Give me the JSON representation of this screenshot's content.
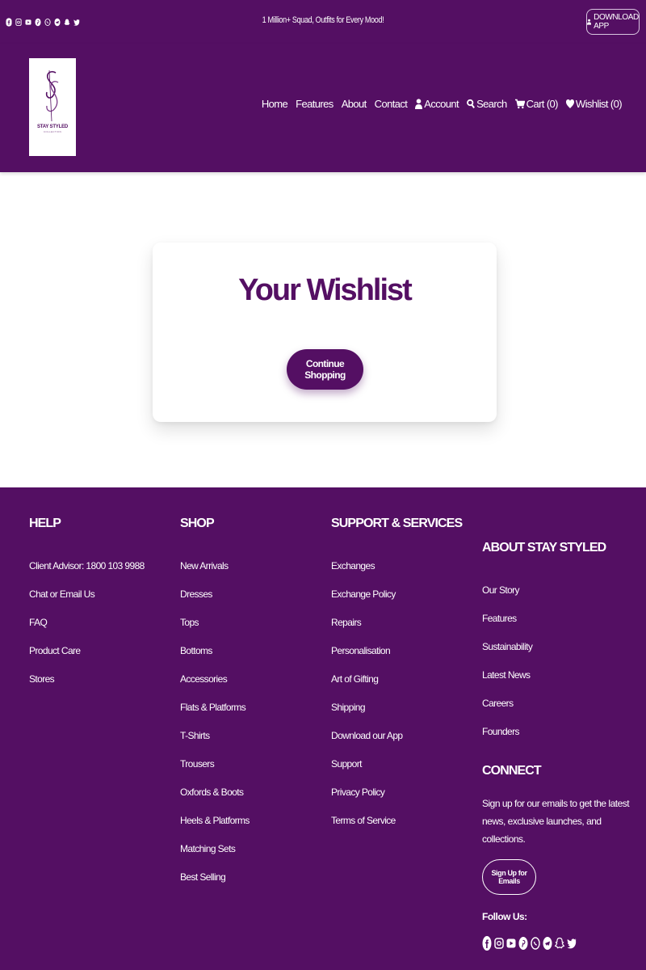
{
  "topbar": {
    "announcement": "1 Million+ Squad, Outfits for Every Mood!",
    "download_label": "DOWNLOAD APP",
    "social_icons": [
      "facebook-icon",
      "instagram-icon",
      "youtube-icon",
      "pinterest-icon",
      "whatsapp-icon",
      "telegram-icon",
      "snapchat-icon",
      "twitter-icon"
    ]
  },
  "logo": {
    "brand": "STAY STYLED",
    "sub": "COLLECTION"
  },
  "nav": {
    "home": "Home",
    "features": "Features",
    "about": "About",
    "contact": "Contact",
    "account": "Account",
    "search": "Search",
    "cart": "Cart (0)",
    "wishlist": "Wishlist (0)"
  },
  "main": {
    "title": "Your Wishlist",
    "continue_label": "Continue Shopping"
  },
  "footer": {
    "help": {
      "heading": "HELP",
      "items": [
        "Client Advisor: 1800 103 9988",
        "Chat or Email Us",
        "FAQ",
        "Product Care",
        "Stores"
      ]
    },
    "shop": {
      "heading": "SHOP",
      "items": [
        "New Arrivals",
        "Dresses",
        "Tops",
        "Bottoms",
        "Accessories",
        "Flats & Platforms",
        "T-Shirts",
        "Trousers",
        "Oxfords & Boots",
        "Heels & Platforms",
        "Matching Sets",
        "Best Selling"
      ]
    },
    "support": {
      "heading": "SUPPORT & SERVICES",
      "items": [
        "Exchanges",
        "Exchange Policy",
        "Repairs",
        "Personalisation",
        "Art of Gifting",
        "Shipping",
        "Download our App",
        "Support",
        "Privacy Policy",
        "Terms of Service"
      ]
    },
    "about": {
      "heading": "ABOUT STAY STYLED",
      "items": [
        "Our Story",
        "Features",
        "Sustainability",
        "Latest News",
        "Careers",
        "Founders"
      ]
    },
    "connect": {
      "heading": "CONNECT",
      "text": "Sign up for our emails to get the latest news, exclusive launches, and collections.",
      "signup_label": "Sign Up for Emails",
      "follow_label": "Follow Us:"
    }
  },
  "colors": {
    "brand_purple": "#540f63",
    "white": "#ffffff"
  }
}
